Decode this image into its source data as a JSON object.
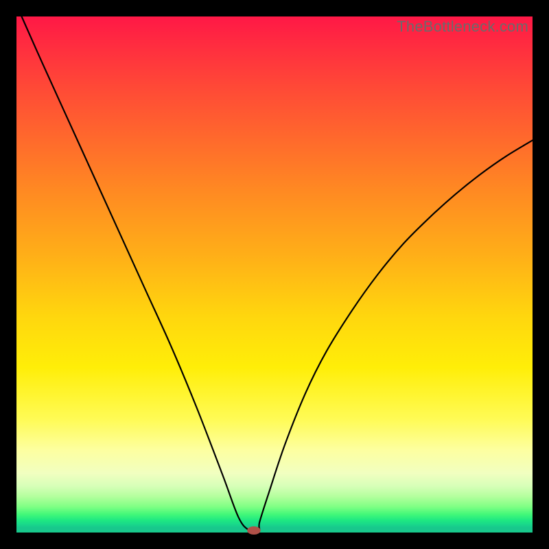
{
  "watermark": "TheBottleneck.com",
  "colors": {
    "frame": "#000000",
    "gradient_top": "#ff1846",
    "gradient_bottom": "#18c88c",
    "curve": "#000000",
    "marker": "#b05048"
  },
  "chart_data": {
    "type": "line",
    "title": "",
    "xlabel": "",
    "ylabel": "",
    "xlim": [
      0,
      100
    ],
    "ylim": [
      0,
      100
    ],
    "series": [
      {
        "name": "curve",
        "x": [
          1,
          5,
          10,
          15,
          20,
          25,
          30,
          35,
          40,
          43,
          45,
          47,
          47.1,
          49,
          52,
          56,
          60,
          65,
          70,
          75,
          80,
          85,
          90,
          95,
          100
        ],
        "y": [
          100,
          91,
          80,
          69,
          58,
          47,
          36,
          24,
          11,
          3,
          0.5,
          0.4,
          2,
          8,
          17,
          27,
          35,
          43,
          50,
          56,
          61,
          65.5,
          69.5,
          73,
          76
        ]
      }
    ],
    "marker": {
      "x": 46,
      "y": 0.4,
      "rx": 1.3,
      "ry": 0.8
    }
  }
}
